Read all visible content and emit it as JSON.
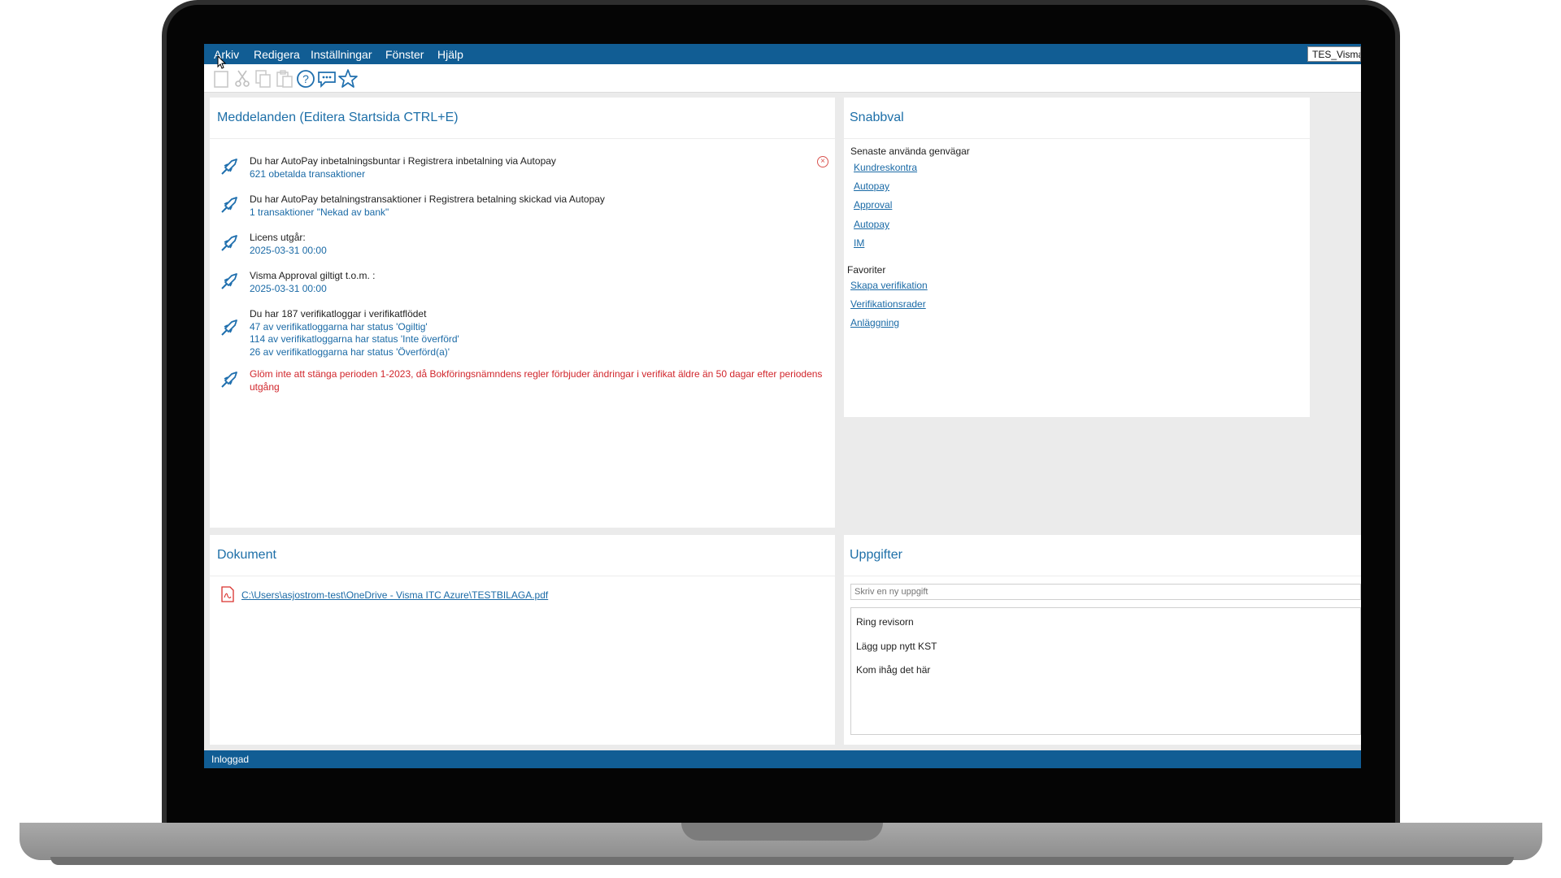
{
  "menu": {
    "items": [
      "Arkiv",
      "Redigera",
      "Inställningar",
      "Fönster",
      "Hjälp"
    ],
    "company": "TES_Visma"
  },
  "toolbar": {
    "icons": [
      "new-document-icon",
      "cut-icon",
      "copy-icon",
      "paste-icon",
      "help-icon",
      "chat-icon",
      "star-icon"
    ]
  },
  "messages": {
    "title": "Meddelanden (Editera Startsida CTRL+E)",
    "items": [
      {
        "lines": [
          {
            "t": "Du har AutoPay inbetalningsbuntar i Registrera inbetalning via Autopay",
            "c": "dark"
          },
          {
            "t": "621 obetalda transaktioner",
            "c": "blue"
          }
        ]
      },
      {
        "lines": [
          {
            "t": "Du har AutoPay betalningstransaktioner i Registrera betalning skickad via Autopay",
            "c": "dark"
          },
          {
            "t": "1 transaktioner \"Nekad av bank\"",
            "c": "blue"
          }
        ]
      },
      {
        "lines": [
          {
            "t": "Licens utgår:",
            "c": "dark"
          },
          {
            "t": "2025-03-31 00:00",
            "c": "blue"
          }
        ]
      },
      {
        "lines": [
          {
            "t": "Visma Approval giltigt t.o.m. :",
            "c": "dark"
          },
          {
            "t": "2025-03-31 00:00",
            "c": "blue"
          }
        ]
      },
      {
        "lines": [
          {
            "t": "Du har 187 verifikatloggar i verifikatflödet",
            "c": "dark"
          },
          {
            "t": "47 av verifikatloggarna har status 'Ogiltig'",
            "c": "blue"
          },
          {
            "t": "114 av verifikatloggarna har status 'Inte överförd'",
            "c": "blue"
          },
          {
            "t": "26 av verifikatloggarna har status 'Överförd(a)'",
            "c": "blue"
          }
        ]
      },
      {
        "lines": [
          {
            "t": "Glöm inte att stänga perioden 1-2023, då Bokföringsnämndens regler förbjuder ändringar i verifikat äldre än 50 dagar efter periodens utgång",
            "c": "red"
          }
        ]
      }
    ]
  },
  "quick": {
    "title": "Snabbval",
    "recent_label": "Senaste använda genvägar",
    "recent": [
      "Kundreskontra",
      "Autopay",
      "Approval",
      "Autopay",
      "IM"
    ],
    "favorites_label": "Favoriter",
    "favorites": [
      "Skapa verifikation",
      "Verifikationsrader",
      "Anläggning"
    ]
  },
  "documents": {
    "title": "Dokument",
    "file": "C:\\Users\\asjostrom-test\\OneDrive - Visma ITC Azure\\TESTBILAGA.pdf"
  },
  "tasks": {
    "title": "Uppgifter",
    "placeholder": "Skriv en ny uppgift",
    "items": [
      "Ring revisorn",
      "Lägg upp nytt KST",
      "Kom ihåg det här"
    ]
  },
  "status": {
    "text": "Inloggad"
  }
}
